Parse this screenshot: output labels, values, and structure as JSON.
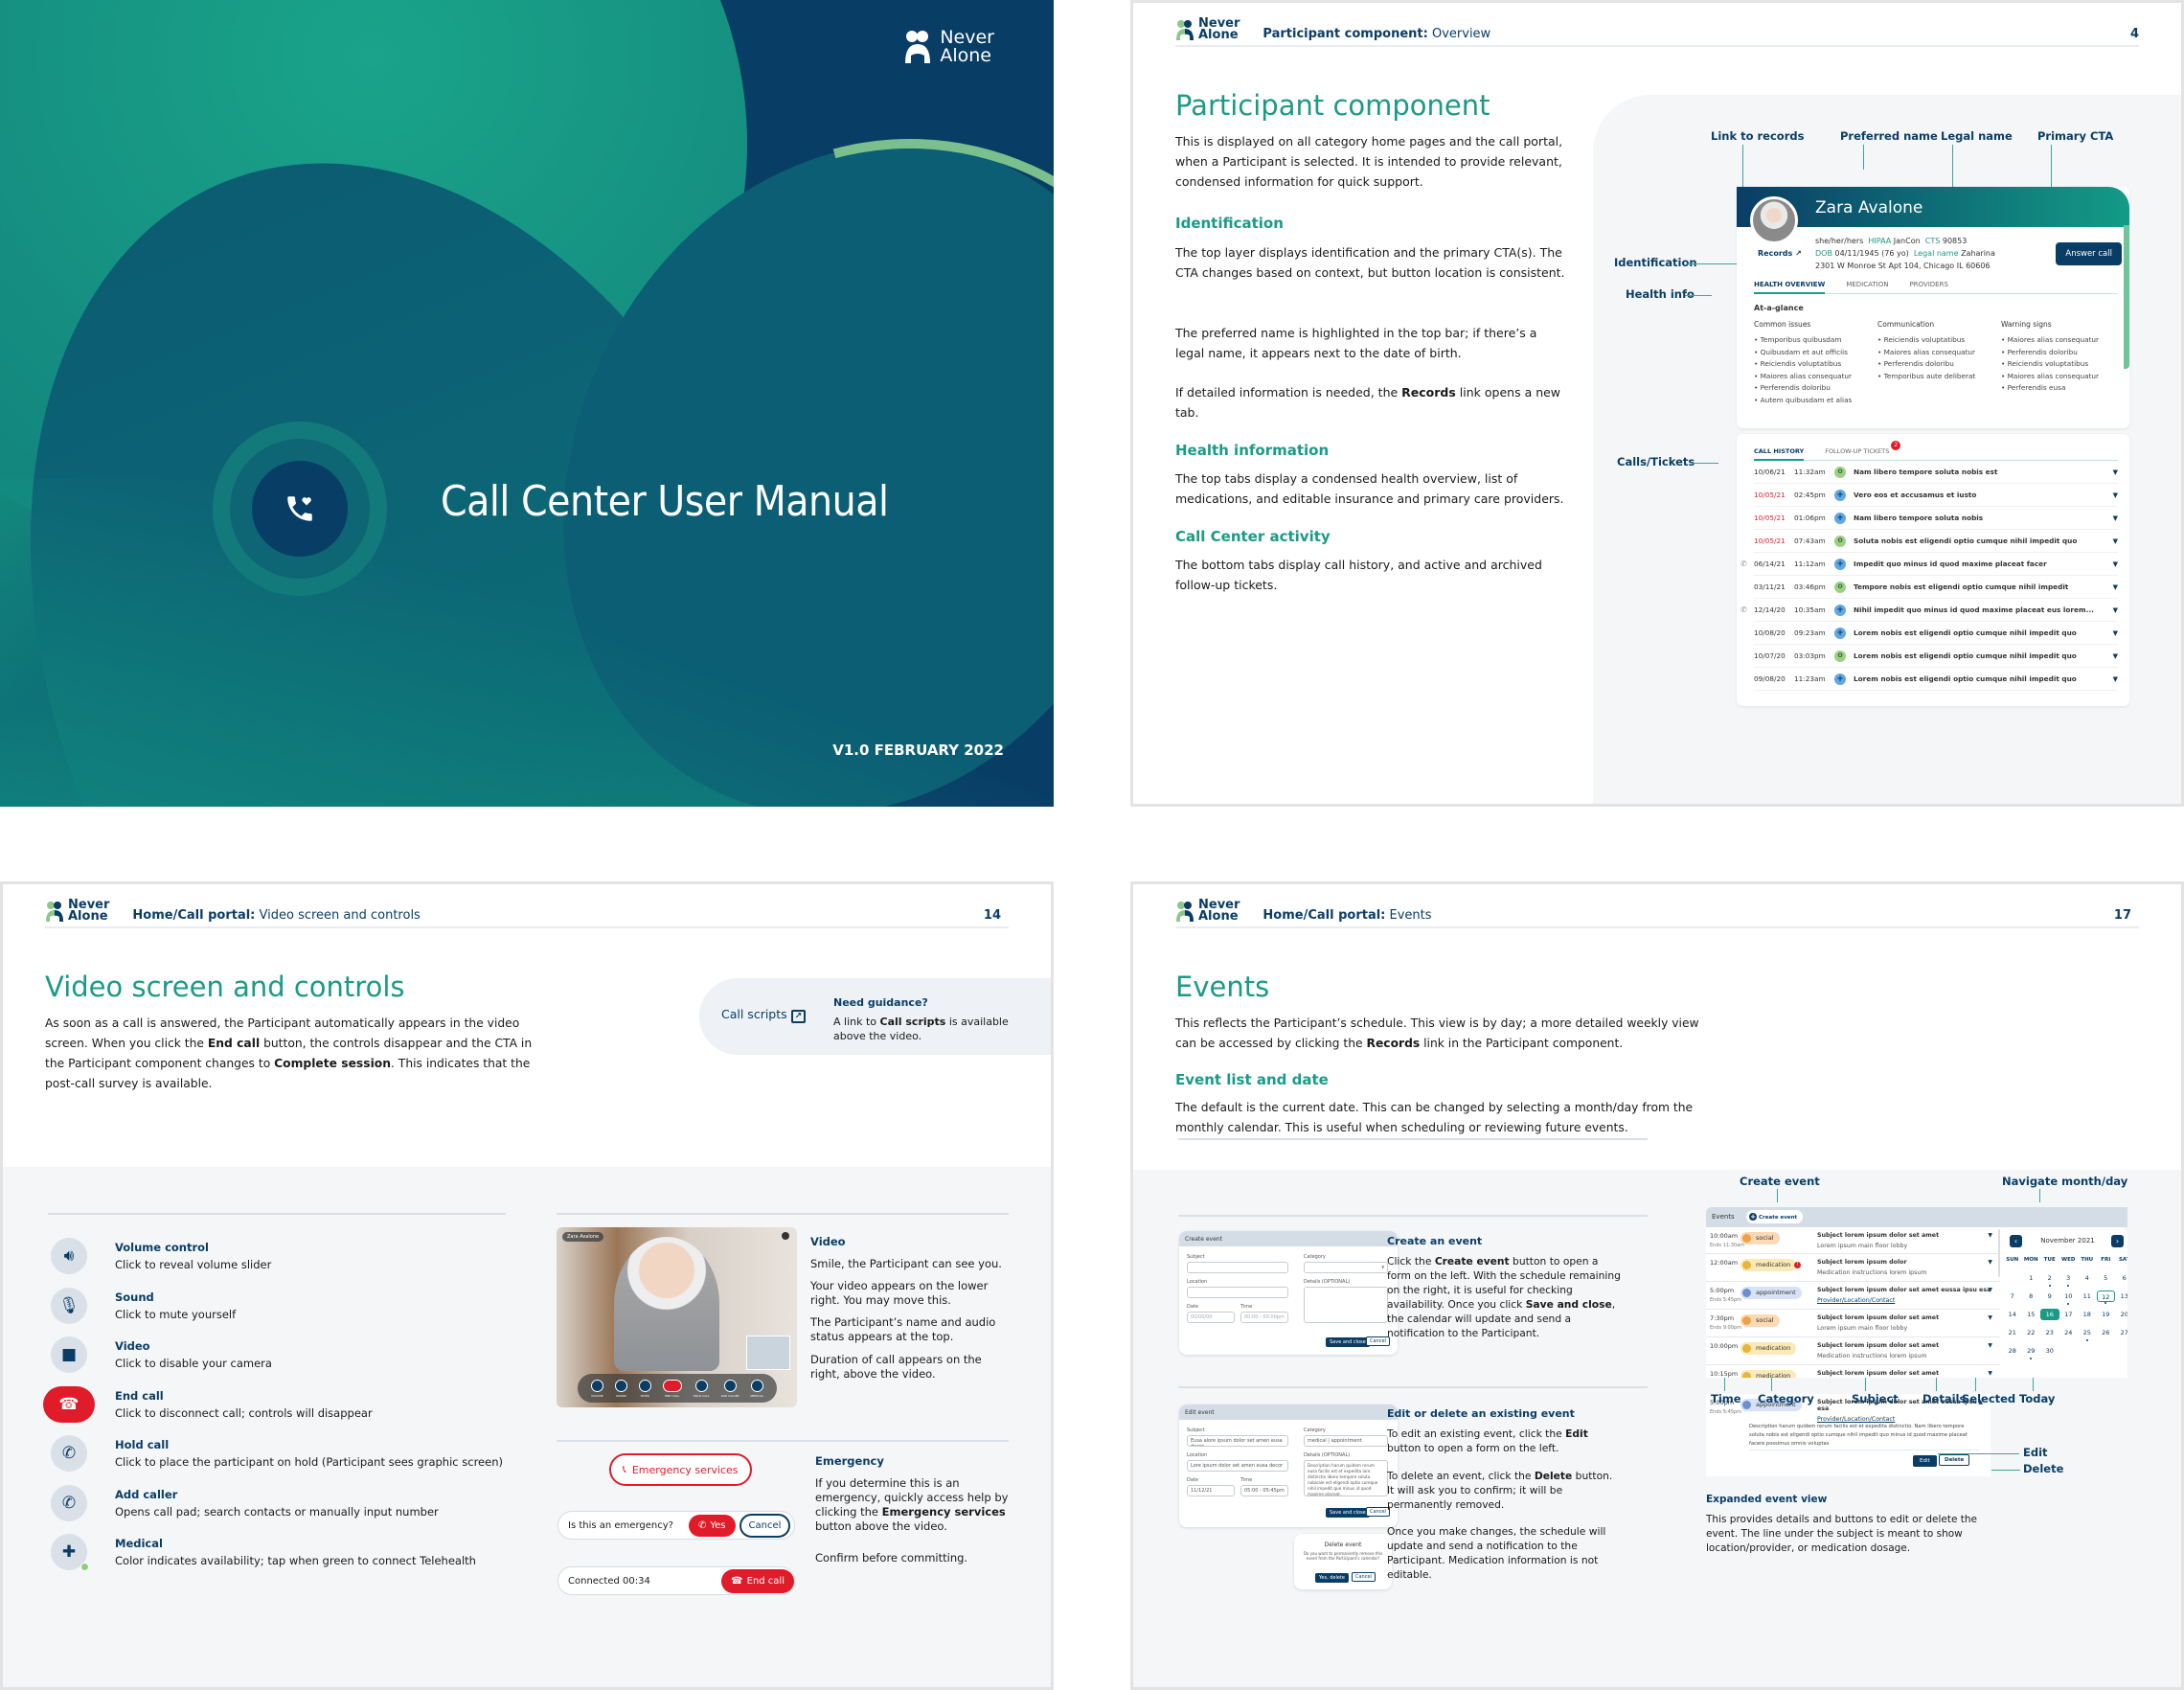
{
  "cover": {
    "brand": [
      "Never",
      "Alone"
    ],
    "title": "Call Center User Manual",
    "version": "V1.0 FEBRUARY 2022",
    "icon": "phone-heart-icon",
    "colors": {
      "teal": "#16957f",
      "navy": "#083d66",
      "accent_green": "#7bbf8c"
    }
  },
  "brand": {
    "line1": "Never",
    "line2": "Alone",
    "navy": "#0a3d66",
    "teal": "#1b9a86",
    "red": "#e11c2a"
  },
  "page4": {
    "crumb_section": "Participant component:",
    "crumb_page": " Overview",
    "page_number": "4",
    "title": "Participant component",
    "intro": "This is displayed on all category home pages and the call portal, when a Participant is selected. It is intended to provide relevant, condensed information for quick support.",
    "identification_heading": "Identification",
    "identification_p1": "The top layer displays identification and the primary CTA(s). The CTA changes based on context, but button location is consistent.",
    "identification_p2": "The preferred name is highlighted in the top bar; if there’s a legal name, it appears next to the date of birth.",
    "identification_p3_a": "If detailed information is needed, the ",
    "identification_p3_b": "Records",
    "identification_p3_c": " link opens a new tab.",
    "health_heading": "Health information",
    "health_p": "The top tabs display a condensed health overview, list of medications, and editable insurance and primary care providers.",
    "activity_heading": "Call Center activity",
    "activity_p": "The bottom tabs display call history, and active and archived follow-up tickets.",
    "callouts": {
      "link_to_records": "Link to records",
      "preferred_name": "Preferred name",
      "legal_name": "Legal name",
      "primary_cta": "Primary CTA",
      "identification": "Identification",
      "health_info": "Health info",
      "calls_tickets": "Calls/Tickets"
    },
    "participant": {
      "name": "Zara Avalone",
      "pronouns": "she/her/hers",
      "hipaa_label": "HIPAA",
      "hipaa_value": "JanCon",
      "cts_label": "CTS",
      "cts_value": "90853",
      "dob_label": "DOB",
      "dob_value": "04/11/1945 (76 yo)",
      "legal_label": "Legal name",
      "legal_value": "Zaharina",
      "address": "2301 W Monroe St Apt 104, Chicago IL 60606",
      "records_link": "Records",
      "cta": "Answer call",
      "tabs": [
        "HEALTH OVERVIEW",
        "MEDICATION",
        "PROVIDERS"
      ],
      "glance_title": "At-a-glance",
      "columns": [
        {
          "title": "Common issues",
          "items": [
            "Temporibus quibusdam",
            "Quibusdam et aut officiis",
            "Reiciendis voluptatibus",
            "Maiores alias consequatur",
            "Perferendis doloribu",
            "Autem quibusdam et alias"
          ]
        },
        {
          "title": "Communication",
          "items": [
            "Reiciendis voluptatibus",
            "Maiores alias consequatur",
            "Perferendis doloribu",
            "Temporibus aute deliberat"
          ]
        },
        {
          "title": "Warning signs",
          "items": [
            "Maiores alias consequatur",
            "Perferendis doloribu",
            "Reiciendis voluptatibus",
            "Maiores alias consequatur",
            "Perferendis eusa"
          ]
        }
      ],
      "history_tabs": [
        "CALL HISTORY",
        "FOLLOW-UP TICKETS"
      ],
      "tickets_badge": "2",
      "history": [
        {
          "date": "10/06/21",
          "time": "11:32am",
          "type": "green",
          "subject": "Nam libero tempore soluta nobis est",
          "overdue": false,
          "call": false
        },
        {
          "date": "10/05/21",
          "time": "02:45pm",
          "type": "blue",
          "subject": "Vero eos et accusamus et iusto",
          "overdue": true,
          "call": false
        },
        {
          "date": "10/05/21",
          "time": "01:06pm",
          "type": "blue",
          "subject": "Nam libero tempore soluta nobis",
          "overdue": true,
          "call": false
        },
        {
          "date": "10/05/21",
          "time": "07:43am",
          "type": "green",
          "subject": "Soluta nobis est eligendi optio cumque nihil impedit quo",
          "overdue": true,
          "call": false
        },
        {
          "date": "06/14/21",
          "time": "11:12am",
          "type": "blue",
          "subject": "Impedit quo minus id quod maxime placeat facer",
          "overdue": false,
          "call": true
        },
        {
          "date": "03/11/21",
          "time": "03:46pm",
          "type": "green",
          "subject": "Tempore nobis est eligendi optio cumque nihil impedit",
          "overdue": false,
          "call": false
        },
        {
          "date": "12/14/20",
          "time": "10:35am",
          "type": "blue",
          "subject": "Nihil impedit quo minus id quod maxime placeat eus lorem...",
          "overdue": false,
          "call": true
        },
        {
          "date": "10/08/20",
          "time": "09:23am",
          "type": "blue",
          "subject": "Lorem nobis est eligendi optio cumque nihil impedit quo",
          "overdue": false,
          "call": false
        },
        {
          "date": "10/07/20",
          "time": "03:03pm",
          "type": "green",
          "subject": "Lorem nobis est eligendi optio cumque nihil impedit quo",
          "overdue": false,
          "call": false
        },
        {
          "date": "09/08/20",
          "time": "11:23am",
          "type": "blue",
          "subject": "Lorem nobis est eligendi optio cumque nihil impedit quo",
          "overdue": false,
          "call": false
        }
      ]
    }
  },
  "page14": {
    "crumb_section": "Home/Call portal:",
    "crumb_page": " Video screen and controls",
    "page_number": "14",
    "title": "Video screen and controls",
    "intro_a": "As soon as a call is answered, the Participant automatically appears in the video screen. When you click the ",
    "intro_b": "End call",
    "intro_c": " button, the controls disappear and the CTA in the Participant component changes to ",
    "intro_d": "Complete session",
    "intro_e": ". This indicates that the post-call survey is available.",
    "call_scripts_link": "Call scripts",
    "guidance_title": "Need guidance?",
    "guidance_a": "A link to ",
    "guidance_b": "Call scripts",
    "guidance_c": " is available above the video.",
    "controls": [
      {
        "icon": "volume-icon",
        "title": "Volume control",
        "desc": "Click to reveal volume slider"
      },
      {
        "icon": "microphone-icon",
        "title": "Sound",
        "desc": "Click to mute yourself"
      },
      {
        "icon": "video-camera-icon",
        "title": "Video",
        "desc": "Click to disable your camera"
      },
      {
        "icon": "end-call-icon",
        "title": "End call",
        "desc": "Click to disconnect call; controls will disappear"
      },
      {
        "icon": "hold-call-icon",
        "title": "Hold call",
        "desc": "Click to place the participant on hold (Participant sees graphic screen)"
      },
      {
        "icon": "add-caller-icon",
        "title": "Add caller",
        "desc": "Opens call pad; search contacts or manually input number"
      },
      {
        "icon": "medical-icon",
        "title": "Medical",
        "desc": "Color indicates availability; tap when green to connect Telehealth"
      }
    ],
    "video_name_tag": "Zara Avalone",
    "video_bar_labels": [
      "VOLUME",
      "SOUND",
      "VIDEO",
      "END CALL",
      "HOLD CALL",
      "ADD CALLER",
      "MEDICAL"
    ],
    "video_heading": "Video",
    "video_p1": "Smile, the Participant can see you.",
    "video_p2": "Your video appears on the lower right. You may move this.",
    "video_p3": "The Participant’s name and audio status appears at the top.",
    "video_p4": "Duration of call appears on the right, above the video.",
    "emergency_button": "Emergency services",
    "emergency_question": "Is this an emergency?",
    "yes_label": "Yes",
    "cancel_label": "Cancel",
    "connected_label": "Connected 00:34",
    "end_call_label": "End call",
    "emergency_heading": "Emergency",
    "emergency_a": "If you determine this is an emergency, quickly access help by clicking the ",
    "emergency_b": "Emergency services",
    "emergency_c": " button above the video.",
    "emergency_p2": "Confirm before committing."
  },
  "page17": {
    "crumb_section": "Home/Call portal:",
    "crumb_page": " Events",
    "page_number": "17",
    "title": "Events",
    "intro_a": "This reflects the Participant’s schedule. This view is by day; a more detailed weekly view can be accessed by clicking the ",
    "intro_b": "Records",
    "intro_c": " link in the Participant component.",
    "list_heading": "Event list and date",
    "list_p": "The default is the current date. This can be changed by selecting a month/day from the monthly calendar. This is useful when scheduling or reviewing future events.",
    "create_form": {
      "title": "Create event",
      "subject": "Subject",
      "category": "Category",
      "location": "Location",
      "details": "Details (OPTIONAL)",
      "date": "Date",
      "time": "Time",
      "date_ph": "00/00/00",
      "time_ph": "00:00 - 00:00pm",
      "save": "Save and close",
      "cancel": "Cancel"
    },
    "create_heading": "Create an event",
    "create_a": "Click the ",
    "create_b": "Create event",
    "create_c": " button to open a form on the left. With the schedule remaining on the right, it is useful for checking availability. Once you click ",
    "create_d": "Save and close",
    "create_e": ", the calendar will update and send a notification to the Participant.",
    "edit_form": {
      "title": "Edit event",
      "subject_val": "Eusa alore ipsum dolor set amen eusa decor",
      "category_val": "medical | appointment",
      "location_val": "Lore ipsum dolor set amen eusa decor",
      "details_val": "Description harum quidem rerum eusa facilis est et expedita iore distinctio libero tempore soluta nobisale est eligendi optio cumque nihil impedit quo minus id quod maxime placeat.",
      "date_val": "11/12/21",
      "time_val": "05:00 - 05:45pm"
    },
    "delete_dialog": {
      "title": "Delete event",
      "text": "Do you want to permanently remove this event from the Participant’s calendar?",
      "yes": "Yes, delete",
      "cancel": "Cancel"
    },
    "edit_heading": "Edit or delete an existing event",
    "edit_a": "To edit an existing event, click the ",
    "edit_b": "Edit",
    "edit_c": " button to open a form on the left.",
    "delete_a": "To delete an event, click the ",
    "delete_b": "Delete",
    "delete_c": " button. It will ask you to confirm; it will be permanently removed.",
    "changes_p": "Once you make changes, the schedule will update and send a notification to the Participant. Medication information is not editable.",
    "callouts": {
      "create_event": "Create event",
      "navigate": "Navigate month/day",
      "time": "Time",
      "category": "Category",
      "subject": "Subject",
      "details": "Details",
      "selected": "Selected",
      "today": "Today",
      "edit": "Edit",
      "delete": "Delete"
    },
    "events_label": "Events",
    "create_event_btn": "Create event",
    "events": [
      {
        "time": "10:00am",
        "ends": "Ends 11:30am",
        "category": "social",
        "subject": "Subject lorem ipsum dolor set amet",
        "line2": "Lorem ipsum main floor lobby",
        "link": false,
        "badge": false
      },
      {
        "time": "12:00am",
        "ends": "",
        "category": "medication",
        "subject": "Subject lorem ipsum dolor",
        "line2": "Medication instructions lorem ipsum",
        "link": false,
        "badge": true
      },
      {
        "time": "5:00pm",
        "ends": "Ends 5:45pm",
        "category": "appointment",
        "subject": "Subject lorem ipsum dolor set amet eussa ipsu esa",
        "line2": "Provider/Location/Contact",
        "link": true,
        "badge": false
      },
      {
        "time": "7:30pm",
        "ends": "Ends 9:00pm",
        "category": "social",
        "subject": "Subject lorem ipsum dolor set amet",
        "line2": "Lorem ipsum main floor lobby",
        "link": false,
        "badge": false
      },
      {
        "time": "10:00pm",
        "ends": "",
        "category": "medication",
        "subject": "Subject lorem ipsum dolor set amet",
        "line2": "Medication instructions lorem ipsum",
        "link": false,
        "badge": false
      },
      {
        "time": "10:15pm",
        "ends": "",
        "category": "medication",
        "subject": "Subject lorem ipsum dolor set amet",
        "line2": "",
        "link": false,
        "badge": false
      }
    ],
    "calendar": {
      "month": "November 2021",
      "weekdays": [
        "SUN",
        "MON",
        "TUE",
        "WED",
        "THU",
        "FRI",
        "SAT"
      ],
      "first_weekday": 1,
      "days_in_month": 30,
      "event_days": [
        2,
        3,
        10,
        12,
        16,
        25,
        29
      ],
      "selected": 16,
      "today": 12
    },
    "expanded": {
      "time": "5:00pm",
      "ends": "Ends 5:45pm",
      "category": "appointment",
      "subject": "Subject lorem ipsum dolor set amet eussa ipsu esa",
      "line2": "Provider/Location/Contact",
      "desc": "Description harum quidem rerum facilis est et expedita distinctio. Nam libero tempore soluta nobis est eligendi optio cumque nihil impedit quo minus id quod maxime placeat facere possimus omnis voluptas",
      "edit": "Edit",
      "delete": "Delete"
    },
    "expanded_heading": "Expanded event view",
    "expanded_p": "This provides details and buttons to edit or delete the event. The line under the subject is meant to show location/provider, or medication dosage."
  }
}
